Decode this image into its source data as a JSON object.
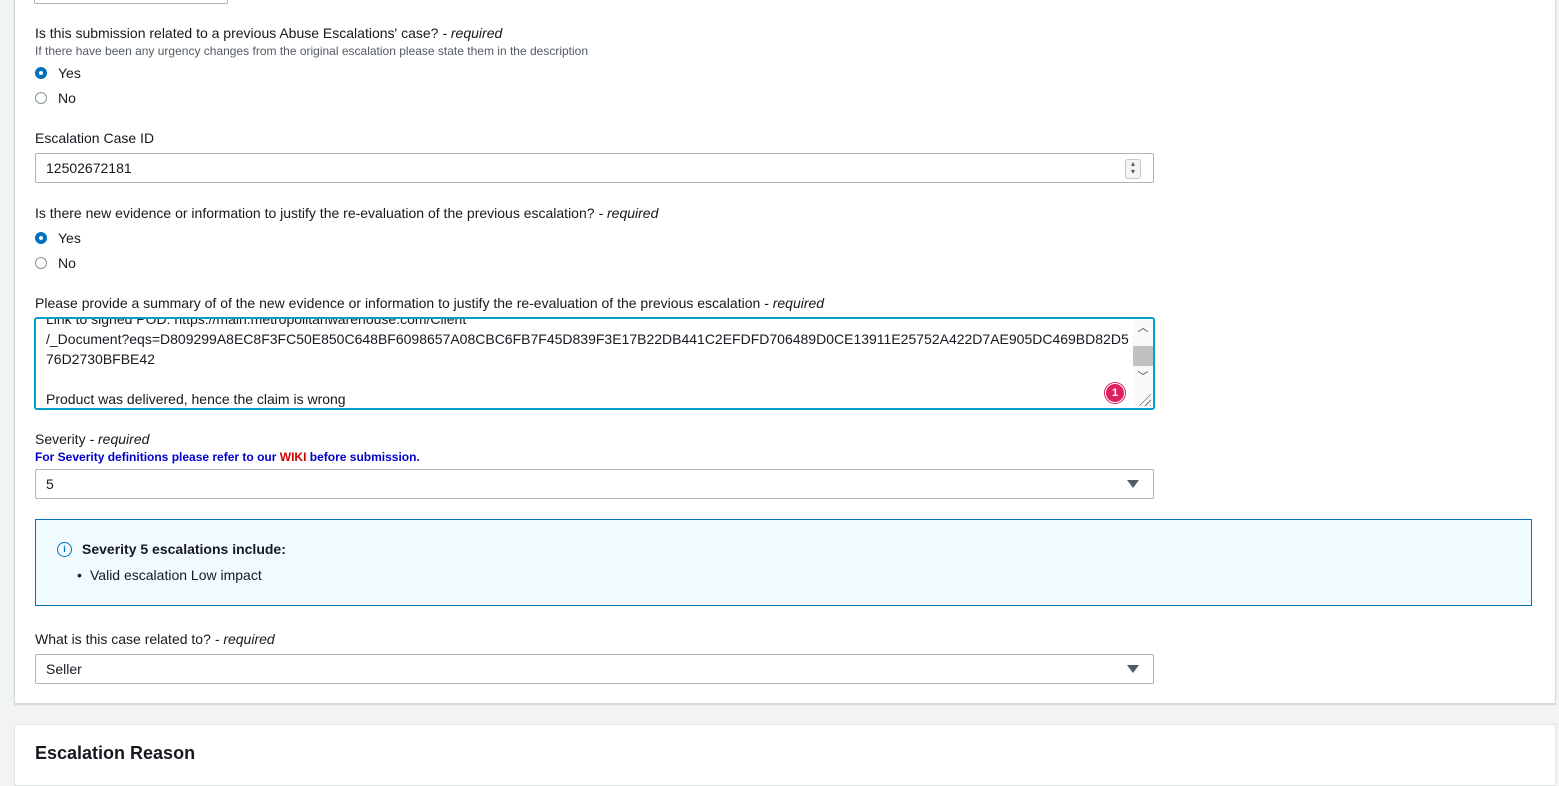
{
  "q_previous_case": {
    "label": "Is this submission related to a previous Abuse Escalations' case?",
    "required": "- required",
    "hint": "If there have been any urgency changes from the original escalation please state them in the description",
    "options": [
      "Yes",
      "No"
    ],
    "selected": "Yes"
  },
  "escalation_case_id": {
    "label": "Escalation Case ID",
    "value": "12502672181"
  },
  "q_new_evidence": {
    "label": "Is there new evidence or information to justify the re-evaluation of the previous escalation?",
    "required": "- required",
    "options": [
      "Yes",
      "No"
    ],
    "selected": "Yes"
  },
  "summary": {
    "label": "Please provide a summary of of the new evidence or information to justify the re-evaluation of the previous escalation",
    "required": "- required",
    "lines": [
      "Link to signed POD: https://main.metropolitanwarehouse.com/Client",
      "/_Document?eqs=D809299A8EC8F3FC50E850C648BF6098657A08CBC6FB7F45D839F3E17B22DB441C2EFDFD706489D0CE13911E25752A422D7AE905DC469BD82D5",
      "76D2730BFBE42",
      "",
      "Product was delivered, hence the claim is wrong"
    ],
    "badge_count": "1"
  },
  "severity": {
    "label": "Severity",
    "required": "- required",
    "note_prefix": "For Severity definitions please refer to our",
    "note_link": "WIKI",
    "note_suffix": "before submission.",
    "value": "5"
  },
  "severity_info": {
    "title": "Severity 5 escalations include:",
    "items": [
      "Valid escalation Low impact"
    ]
  },
  "related_to": {
    "label": "What is this case related to?",
    "required": "- required",
    "value": "Seller"
  },
  "next_section": {
    "title": "Escalation Reason"
  },
  "colors": {
    "accent": "#0073bb",
    "focus": "#00a1c9",
    "badge": "#e0215f",
    "wiki": "#cc0000"
  }
}
